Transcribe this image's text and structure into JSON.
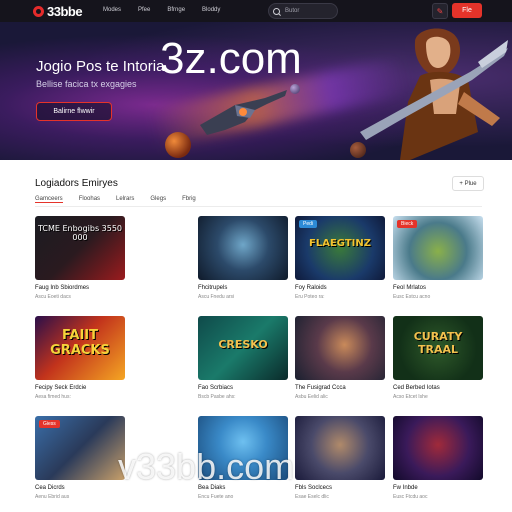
{
  "header": {
    "brand": "33bbe",
    "nav": [
      "Modes",
      "Pfee",
      "Bfrnge",
      "Bloddy"
    ],
    "search_placeholder": "Butor",
    "cta_label": "Fle"
  },
  "hero": {
    "watermark": "3z.com",
    "title": "Jogio Pos te Intoria",
    "subtitle": "Bellise facica tx exgagies",
    "button_label": "Balirne flwwir"
  },
  "section": {
    "title": "Logiadors   Emiryes",
    "more_label": "Plue",
    "tabs": [
      "Gamceers",
      "Floohas",
      "Lelrars",
      "Glegs",
      "Fbrig"
    ]
  },
  "games": [
    {
      "title": "Faug Inb Sbiordmes",
      "meta": "Ascu Eoeti dacs",
      "art_text": "TCME Enbogibs 3550 000"
    },
    {
      "title": "Fhcitrupels",
      "meta": "Ascu Fnedu arsi",
      "art_text": ""
    },
    {
      "title": "Foy Raloids",
      "meta": "Eru Poteo ra:",
      "art_text": "FLAEGTINZ",
      "badge": "Pedi"
    },
    {
      "title": "Feol Mrlatos",
      "meta": "Eusc Estcu acno",
      "art_text": "",
      "badge": "Bieck"
    },
    {
      "title": "Fecipy Seck Erdcie",
      "meta": "Aesa fimed hus:",
      "art_text": "FAIIT GRACKS"
    },
    {
      "title": "Fao Scrbiacs",
      "meta": "Bscb Pasbe ahs:",
      "art_text": "CRESKO"
    },
    {
      "title": "The Fusigrad Ccca",
      "meta": "Asbu Eelid alic",
      "art_text": ""
    },
    {
      "title": "Ced Berbed Iotas",
      "meta": "Acso Etcet Ishe",
      "art_text": "CURATY TRAAL"
    },
    {
      "title": "Cea Dicrds",
      "meta": "Aenu Ebrid aus",
      "art_text": "",
      "badge": "Giess"
    },
    {
      "title": "Bea Diaks",
      "meta": "Encu Fuete ano",
      "art_text": ""
    },
    {
      "title": "Fbls Soclcecs",
      "meta": "Esae Eselc dlic",
      "art_text": ""
    },
    {
      "title": "Fw Inbde",
      "meta": "Eusc Ftcdu aoc",
      "art_text": ""
    }
  ],
  "footer_watermark": "v33bb.com"
}
